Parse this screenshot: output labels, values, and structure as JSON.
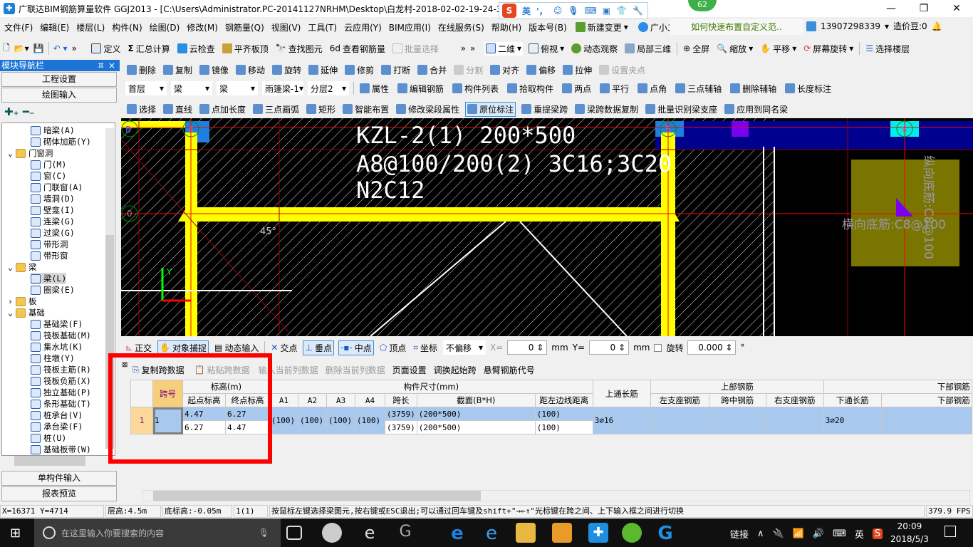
{
  "window": {
    "title": "广联达BIM钢筋算量软件 GGJ2013 - [C:\\Users\\Administrator.PC-20141127NRHM\\Desktop\\白龙村-2018-02-02-19-24-35",
    "minimize": "—",
    "restore": "❐",
    "close": "✕",
    "badge": "62"
  },
  "ime": {
    "logo": "S",
    "lang": "英",
    "punct": "'，",
    "icons": [
      "smile-icon",
      "mic-icon",
      "keyboard-icon",
      "user-card-icon",
      "shirt-icon",
      "wrench-icon"
    ]
  },
  "menu": [
    "文件(F)",
    "编辑(E)",
    "楼层(L)",
    "构件(N)",
    "绘图(D)",
    "修改(M)",
    "钢筋量(Q)",
    "视图(V)",
    "工具(T)",
    "云应用(Y)",
    "BIM应用(I)",
    "在线服务(S)",
    "帮助(H)",
    "版本号(B)",
    "新建变更",
    "广小二"
  ],
  "tip": "如何快速布置自定义范..",
  "account": {
    "phone": "13907298339",
    "beans": "造价豆:0"
  },
  "toolbar1": {
    "items": [
      "定义",
      "汇总计算",
      "云检查",
      "平齐板顶",
      "查找图元",
      "查看钢筋量",
      "批量选择"
    ],
    "view": [
      "二维",
      "俯视",
      "动态观察",
      "局部三维",
      "全屏",
      "缩放",
      "平移",
      "屏幕旋转",
      "选择楼层"
    ]
  },
  "toolbar2": [
    "删除",
    "复制",
    "镜像",
    "移动",
    "旋转",
    "延伸",
    "修剪",
    "打断",
    "合并",
    "分割",
    "对齐",
    "偏移",
    "拉伸",
    "设置夹点"
  ],
  "toolbar3": {
    "combos": [
      "首层",
      "梁",
      "梁",
      "雨篷梁-1",
      "分层2"
    ],
    "items": [
      "属性",
      "编辑钢筋",
      "构件列表",
      "拾取构件",
      "两点",
      "平行",
      "点角",
      "三点辅轴",
      "删除辅轴",
      "长度标注"
    ]
  },
  "toolbar4": [
    "选择",
    "直线",
    "点加长度",
    "三点画弧",
    "矩形",
    "智能布置",
    "修改梁段属性",
    "原位标注",
    "重提梁跨",
    "梁跨数据复制",
    "批量识别梁支座",
    "应用到同名梁"
  ],
  "nav": {
    "title": "模块导航栏",
    "pin": "ㅍ",
    "close": "×",
    "tabs": [
      "工程设置",
      "绘图输入"
    ],
    "bottom_tabs": [
      "单构件输入",
      "报表预览"
    ],
    "tree": [
      {
        "label": "暗梁(A)",
        "lvl": 2
      },
      {
        "label": "砌体加筋(Y)",
        "lvl": 2
      },
      {
        "label": "门窗洞",
        "lvl": 1,
        "folder": true
      },
      {
        "label": "门(M)",
        "lvl": 2
      },
      {
        "label": "窗(C)",
        "lvl": 2
      },
      {
        "label": "门联窗(A)",
        "lvl": 2
      },
      {
        "label": "墙洞(D)",
        "lvl": 2
      },
      {
        "label": "壁龛(I)",
        "lvl": 2
      },
      {
        "label": "连梁(G)",
        "lvl": 2
      },
      {
        "label": "过梁(G)",
        "lvl": 2
      },
      {
        "label": "带形洞",
        "lvl": 2
      },
      {
        "label": "带形窗",
        "lvl": 2
      },
      {
        "label": "梁",
        "lvl": 1,
        "folder": true
      },
      {
        "label": "梁(L)",
        "lvl": 2,
        "selected": true
      },
      {
        "label": "圈梁(E)",
        "lvl": 2
      },
      {
        "label": "板",
        "lvl": 1,
        "folder": true,
        "collapsed": true
      },
      {
        "label": "基础",
        "lvl": 1,
        "folder": true
      },
      {
        "label": "基础梁(F)",
        "lvl": 2
      },
      {
        "label": "筏板基础(M)",
        "lvl": 2
      },
      {
        "label": "集水坑(K)",
        "lvl": 2
      },
      {
        "label": "柱墩(Y)",
        "lvl": 2
      },
      {
        "label": "筏板主筋(R)",
        "lvl": 2
      },
      {
        "label": "筏板负筋(X)",
        "lvl": 2
      },
      {
        "label": "独立基础(P)",
        "lvl": 2
      },
      {
        "label": "条形基础(T)",
        "lvl": 2
      },
      {
        "label": "桩承台(V)",
        "lvl": 2
      },
      {
        "label": "承台梁(F)",
        "lvl": 2
      },
      {
        "label": "桩(U)",
        "lvl": 2
      },
      {
        "label": "基础板带(W)",
        "lvl": 2
      }
    ]
  },
  "canvas": {
    "beam_label": [
      "KZL-2(1) 200*500",
      "A8@100/200(2) 3C16;3C20",
      "N2C12"
    ],
    "angle": "45°",
    "axis_y": "Y",
    "axis_markers": [
      "B",
      "4",
      "5",
      "6",
      "0"
    ],
    "slab_h": "横向底筋:C8@100",
    "slab_v": "纵向底筋:C8@100"
  },
  "snap": {
    "items": [
      "正交",
      "对象捕捉",
      "动态输入",
      "交点",
      "垂点",
      "中点",
      "顶点",
      "坐标"
    ],
    "offset": "不偏移",
    "x_label": "X=",
    "x": "0",
    "y_label": "Y=",
    "y": "0",
    "unit": "mm",
    "rotate_label": "旋转",
    "rotate": "0.000",
    "deg": "°"
  },
  "grid_toolbar": [
    "复制跨数据",
    "粘贴跨数据",
    "输入当前列数据",
    "删除当前列数据",
    "页面设置",
    "调换起始跨",
    "悬臂钢筋代号"
  ],
  "grid": {
    "h_span": "跨号",
    "h_elev": "标高(m)",
    "h_start": "起点标高",
    "h_end": "终点标高",
    "h_size": "构件尺寸(mm)",
    "h_a": [
      "A1",
      "A2",
      "A3",
      "A4"
    ],
    "h_len": "跨长",
    "h_sec": "截面(B*H)",
    "h_dist": "距左边线距离",
    "h_top": "上通长筋",
    "h_toprebar": "上部钢筋",
    "h_left": "左支座钢筋",
    "h_mid": "跨中钢筋",
    "h_right": "右支座钢筋",
    "h_botrebar": "下部钢筋",
    "h_bot": "下通长筋",
    "h_bot2": "下部钢筋",
    "row": {
      "num": "1",
      "span": "1",
      "start": [
        "4.47",
        "6.27"
      ],
      "end": [
        "6.27",
        "4.47"
      ],
      "a": [
        "(100)",
        "(100)",
        "(100)",
        "(100)"
      ],
      "len": [
        "(3759)",
        "(3759)"
      ],
      "sec": [
        "(200*500)",
        "(200*500)"
      ],
      "dist": [
        "(100)",
        "(100)"
      ],
      "top": "3⌀16",
      "bot": "3⌀20"
    }
  },
  "status": {
    "coords": "X=16371 Y=4714",
    "floor_h": "层高:4.5m",
    "base": "底标高:-0.05m",
    "count": "1(1)",
    "hint": "按鼠标左键选择梁图元,按右键或ESC退出;可以通过回车键及shift+\"→←↑\"光标键在跨之间、上下输入框之间进行切换",
    "fps": "379.9 FPS"
  },
  "taskbar": {
    "search": "在这里输入你要搜索的内容",
    "link": "链接",
    "lang": "英",
    "time": "20:09",
    "date": "2018/5/3"
  },
  "colors": {
    "title_blue": "#1c74d6",
    "beam_yellow": "#ffff00",
    "grid_selected": "#a8c8ee",
    "header_orange": "#f5cf7c",
    "highlight_frame": "#ff0000"
  }
}
